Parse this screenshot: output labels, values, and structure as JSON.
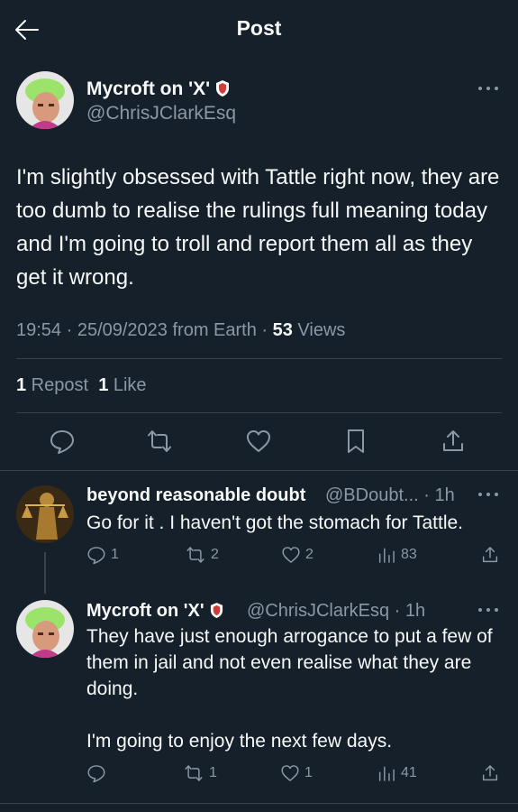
{
  "header": {
    "title": "Post"
  },
  "post": {
    "author_name": "Mycroft on 'X'",
    "handle": "@ChrisJClarkEsq",
    "text": "I'm slightly obsessed with Tattle right now, they are too dumb to realise the rulings full meaning today and I'm going to troll and report them all as they get it wrong.",
    "meta_time": "19:54 · 25/09/2023 from Earth · ",
    "views_count": "53",
    "views_label": " Views",
    "reposts_count": "1",
    "reposts_label": " Repost",
    "likes_count": "1",
    "likes_label": " Like"
  },
  "replies": [
    {
      "name": "beyond reasonable doubt",
      "handle_time": " @BDoubt... · 1h",
      "text": "Go for it . I haven't got the stomach for Tattle.",
      "replies": "1",
      "reposts": "2",
      "likes": "2",
      "views": "83"
    },
    {
      "name": "Mycroft on 'X'",
      "handle_time": " @ChrisJClarkEsq · 1h",
      "text": "They have just enough arrogance to put a few of them in jail and not even realise what they are doing.\n\nI'm going to enjoy the next few days.",
      "replies": "",
      "reposts": "1",
      "likes": "1",
      "views": "41"
    }
  ],
  "colors": {
    "background": "#15202b",
    "text": "#f7f9f9",
    "muted": "#8b98a5",
    "divider": "#38444d"
  },
  "icons": [
    "back-arrow-icon",
    "more-icon",
    "verified-shield-icon",
    "reply-icon",
    "repost-icon",
    "like-icon",
    "bookmark-icon",
    "share-icon",
    "views-icon"
  ]
}
